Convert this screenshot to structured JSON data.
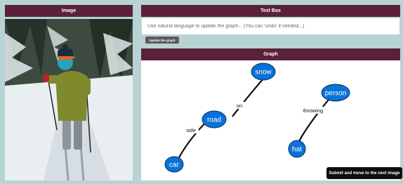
{
  "image_panel": {
    "title": "Image"
  },
  "textbox_panel": {
    "title": "Text Box",
    "placeholder": "Use natural language to update the graph... (You can 'undo' if needed...)",
    "update_button": "Update the graph"
  },
  "graph_panel": {
    "title": "Graph",
    "nodes": {
      "snow": "snow",
      "road": "road",
      "car": "car",
      "person": "person",
      "hat": "hat"
    },
    "edges": {
      "road_snow": "on",
      "car_road": "side",
      "person_hat": "throwing"
    },
    "node_color": "#0a72d6"
  },
  "submit_button": "Submit and move to the next image"
}
